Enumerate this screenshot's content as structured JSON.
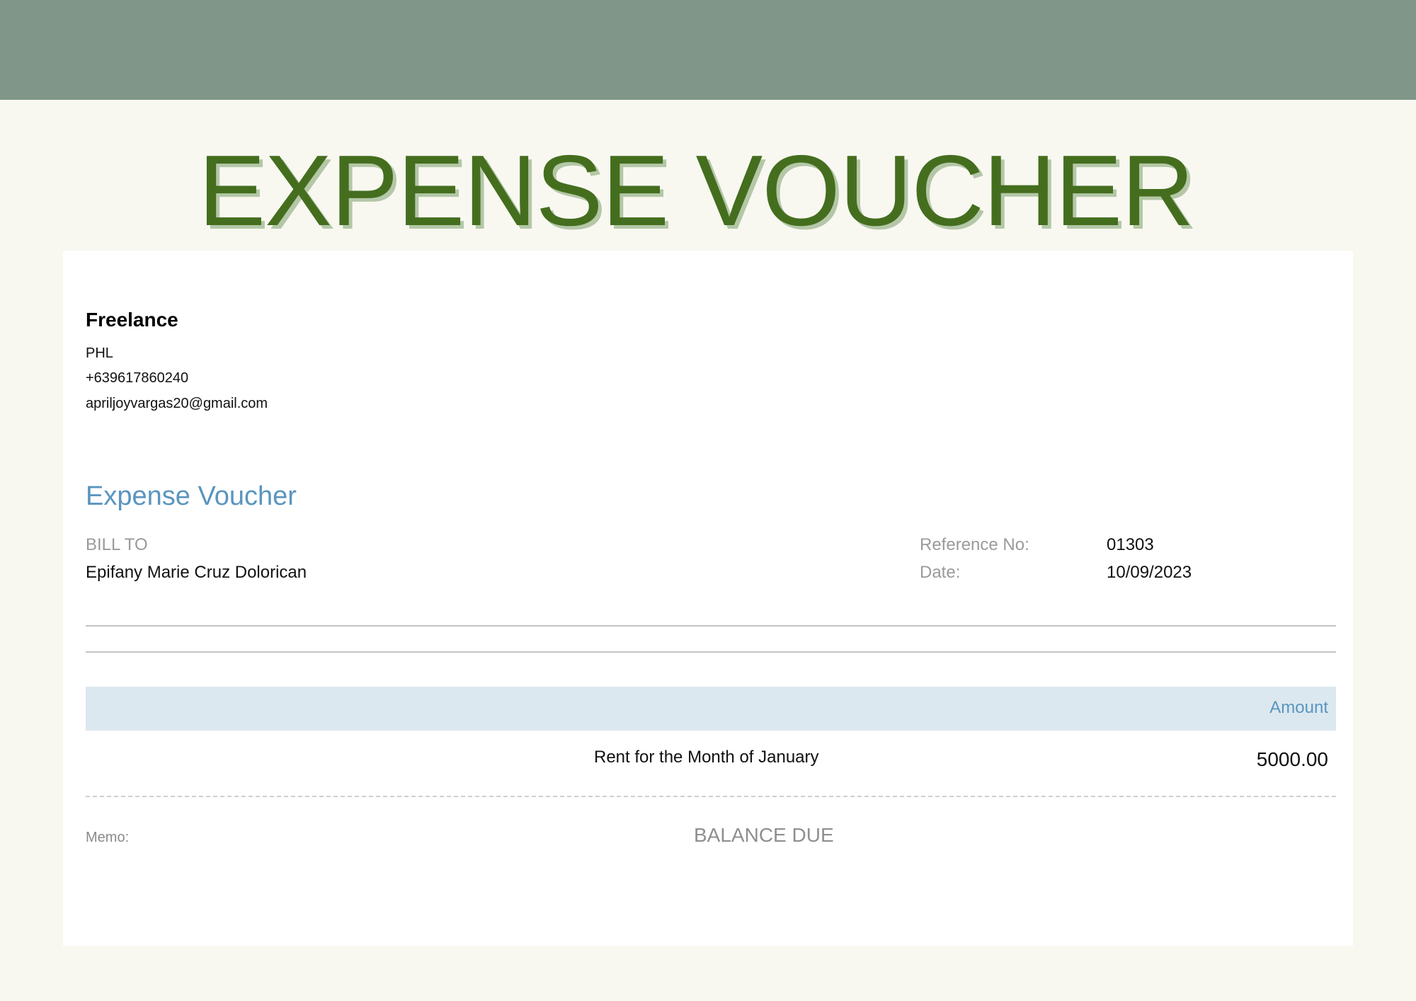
{
  "page": {
    "title": "EXPENSE VOUCHER",
    "colors": {
      "banner": "#7f9688",
      "background": "#f8f8f1",
      "title": "#446e1e",
      "title_shadow": "#b4c7a7",
      "accent_blue": "#5a95bf",
      "table_header_bg": "#dce8ef"
    }
  },
  "company": {
    "name": "Freelance",
    "location": "PHL",
    "phone": "+639617860240",
    "email": "apriljoyvargas20@gmail.com"
  },
  "voucher": {
    "heading": "Expense Voucher",
    "bill_to_label": "BILL TO",
    "bill_to_name": "Epifany Marie Cruz Dolorican",
    "reference_label": "Reference No:",
    "reference_value": "01303",
    "date_label": "Date:",
    "date_value": "10/09/2023"
  },
  "table": {
    "amount_header": "Amount",
    "items": [
      {
        "description": "Rent for the Month of January",
        "amount": "5000.00"
      }
    ]
  },
  "footer": {
    "memo_label": "Memo:",
    "balance_due_label": "BALANCE DUE"
  }
}
